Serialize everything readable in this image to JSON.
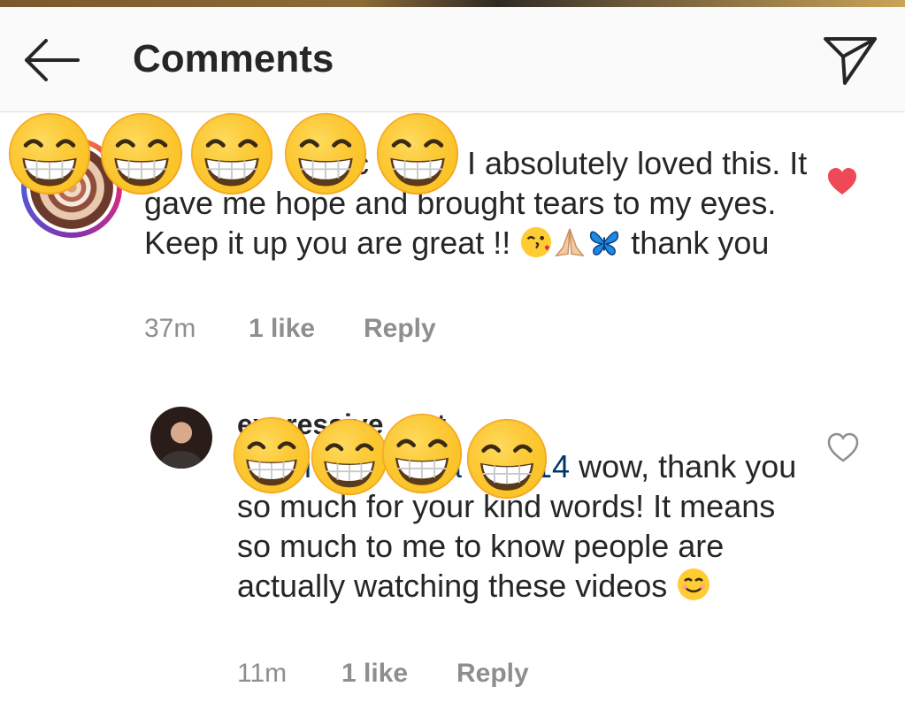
{
  "header": {
    "title": "Comments",
    "back_icon": "arrow-left-icon",
    "share_icon": "paper-plane-icon"
  },
  "comment": {
    "username_visible": "i",
    "username_fragment": "g",
    "username_fragment2": "c",
    "text_line1": "I absolutely loved this.",
    "text_rest": "It gave me hope and brought tears to my eyes.  Keep it up you are great !!",
    "text_end": "thank you",
    "emojis": [
      "kiss-wink-emoji",
      "folded-hands-emoji",
      "butterfly-emoji"
    ],
    "time": "37m",
    "likes": "1 like",
    "reply_label": "Reply",
    "liked": true
  },
  "reply": {
    "username": "expressive",
    "username_tail": "t",
    "mention_fragment_a": "i",
    "mention_fragment_b": "a",
    "mention_suffix": "14",
    "text": "wow, thank you so much for your kind words! It means so much to me to know people are actually watching these videos",
    "emoji": "smiling-face-emoji",
    "time": "11m",
    "likes": "1 like",
    "reply_label": "Reply",
    "liked": false
  },
  "colors": {
    "like_red": "#ed4956",
    "muted": "#8e8e8e",
    "text": "#262626",
    "censor_yellow": "#ffcc33"
  }
}
